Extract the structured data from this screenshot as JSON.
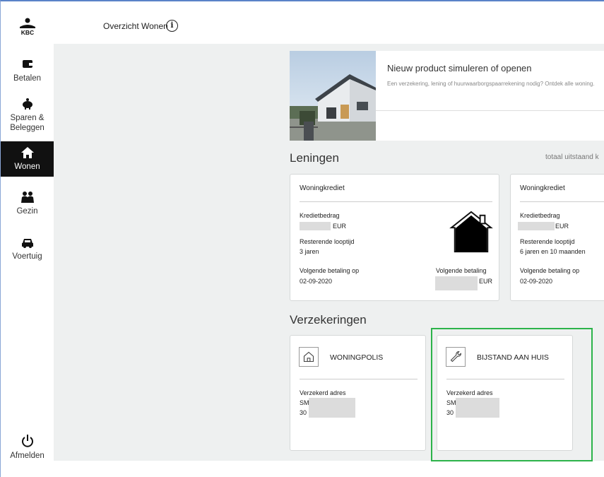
{
  "header": {
    "title": "Overzicht Wonen",
    "info_icon": "i"
  },
  "brand": {
    "logo_text": "KBC"
  },
  "sidebar": {
    "items": [
      {
        "label": "Betalen",
        "icon": "wallet-icon"
      },
      {
        "label": "Sparen &",
        "label2": "Beleggen",
        "icon": "piggy-bank-icon"
      },
      {
        "label": "Wonen",
        "icon": "house-icon",
        "active": true
      },
      {
        "label": "Gezin",
        "icon": "family-icon"
      },
      {
        "label": "Voertuig",
        "icon": "car-icon"
      }
    ],
    "logout": {
      "label": "Afmelden",
      "icon": "power-icon"
    }
  },
  "promo": {
    "title": "Nieuw product simuleren of openen",
    "text": "Een verzekering, lening of huurwaarborgspaarrekening nodig? Ontdek alle woning."
  },
  "loans": {
    "title": "Leningen",
    "total_label": "totaal uitstaand k",
    "cards": [
      {
        "title": "Woningkrediet",
        "amount_label": "Kredietbedrag",
        "amount_currency": "EUR",
        "term_label": "Resterende looptijd",
        "term_value": "3 jaren",
        "next_payment_label": "Volgende betaling op",
        "next_payment_date": "02-09-2020",
        "next_payment_amount_label": "Volgende betaling",
        "next_payment_currency": "EUR"
      },
      {
        "title": "Woningkrediet",
        "amount_label": "Kredietbedrag",
        "amount_currency": "EUR",
        "term_label": "Resterende looptijd",
        "term_value": "6 jaren en 10 maanden",
        "next_payment_label": "Volgende betaling op",
        "next_payment_date": "02-09-2020"
      }
    ]
  },
  "insurance": {
    "title": "Verzekeringen",
    "cards": [
      {
        "title": "WONINGPOLIS",
        "icon": "home-outline-icon",
        "address_label": "Verzekerd adres",
        "line1": "SM",
        "line2": "30"
      },
      {
        "title": "BIJSTAND AAN HUIS",
        "icon": "wrench-icon",
        "address_label": "Verzekerd adres",
        "line1": "SM",
        "line2": "30"
      }
    ]
  },
  "colors": {
    "highlight": "#2cb34a",
    "active_nav": "#111111",
    "background": "#eef0f0"
  }
}
